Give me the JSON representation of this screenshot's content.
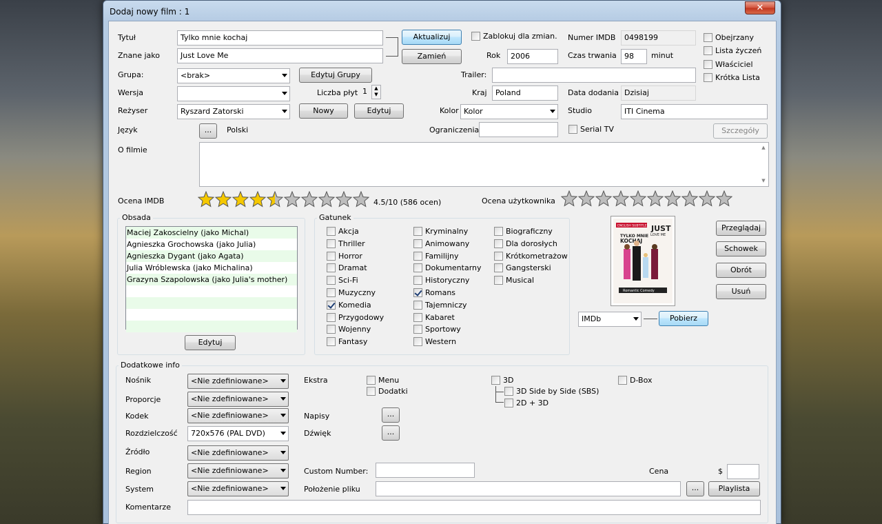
{
  "window": {
    "title": "Dodaj nowy film : 1",
    "close": "✕"
  },
  "main": {
    "title_label": "Tytuł",
    "title_value": "Tylko mnie kochaj",
    "alias_label": "Znane jako",
    "alias_value": "Just Love Me",
    "update_btn": "Aktualizuj",
    "swap_btn": "Zamień",
    "lock_label": "Zablokuj dla zmian.",
    "imdb_number_label": "Numer IMDB",
    "imdb_number_value": "0498199",
    "year_label": "Rok",
    "year_value": "2006",
    "runtime_label": "Czas trwania",
    "runtime_value": "98",
    "runtime_unit": "minut",
    "group_label": "Grupa:",
    "group_value": "<brak>",
    "edit_groups_btn": "Edytuj Grupy",
    "trailer_label": "Trailer:",
    "trailer_value": "",
    "version_label": "Wersja",
    "version_value": "",
    "discs_label": "Liczba płyt",
    "discs_value": "1",
    "country_label": "Kraj",
    "country_value": "Poland",
    "added_label": "Data dodania",
    "added_value": "Dzisiaj",
    "director_label": "Reżyser",
    "director_value": "Ryszard Zatorski",
    "new_btn": "Nowy",
    "edit_btn": "Edytuj",
    "color_label": "Kolor",
    "color_value": "Kolor",
    "studio_label": "Studio",
    "studio_value": "ITI Cinema",
    "language_label": "Język",
    "language_btn": "...",
    "language_value": "Polski",
    "restrictions_label": "Ograniczenia",
    "restrictions_value": "",
    "tv_series_label": "Serial TV",
    "details_btn": "Szczegóły",
    "about_label": "O filmie",
    "about_value": "",
    "imdb_rating_label": "Ocena IMDB",
    "imdb_rating_text": "4.5/10  (586 ocen)",
    "imdb_stars": 4.5,
    "user_rating_label": "Ocena użytkownika",
    "user_stars": 0
  },
  "flags": {
    "watched": "Obejrzany",
    "wishlist": "Lista życzeń",
    "owner": "Właściciel",
    "shortlist": "Krótka Lista"
  },
  "cast": {
    "title": "Obsada",
    "edit_btn": "Edytuj",
    "items": [
      "Maciej Zakoscielny  (jako Michal)",
      "Agnieszka Grochowska  (jako Julia)",
      "Agnieszka Dygant  (jako Agata)",
      "Julia Wróblewska  (jako Michalina)",
      "Grazyna Szapolowska  (jako Julia's mother)"
    ]
  },
  "genres": {
    "title": "Gatunek",
    "items": [
      {
        "label": "Akcja",
        "checked": false
      },
      {
        "label": "Thriller",
        "checked": false
      },
      {
        "label": "Horror",
        "checked": false
      },
      {
        "label": "Dramat",
        "checked": false
      },
      {
        "label": "Sci-Fi",
        "checked": false
      },
      {
        "label": "Muzyczny",
        "checked": false
      },
      {
        "label": "Komedia",
        "checked": true
      },
      {
        "label": "Przygodowy",
        "checked": false
      },
      {
        "label": "Wojenny",
        "checked": false
      },
      {
        "label": "Fantasy",
        "checked": false
      },
      {
        "label": "Kryminalny",
        "checked": false
      },
      {
        "label": "Animowany",
        "checked": false
      },
      {
        "label": "Familijny",
        "checked": false
      },
      {
        "label": "Dokumentarny",
        "checked": false
      },
      {
        "label": "Historyczny",
        "checked": false
      },
      {
        "label": "Romans",
        "checked": true
      },
      {
        "label": "Tajemniczy",
        "checked": false
      },
      {
        "label": "Kabaret",
        "checked": false
      },
      {
        "label": "Sportowy",
        "checked": false
      },
      {
        "label": "Western",
        "checked": false
      },
      {
        "label": "Biograficzny",
        "checked": false
      },
      {
        "label": "Dla dorosłych",
        "checked": false
      },
      {
        "label": "Krótkometrażow",
        "checked": false
      },
      {
        "label": "Gangsterski",
        "checked": false
      },
      {
        "label": "Musical",
        "checked": false
      }
    ]
  },
  "cover": {
    "browse_btn": "Przeglądaj",
    "clipboard_btn": "Schowek",
    "rotate_btn": "Obrót",
    "delete_btn": "Usuń",
    "source_value": "IMDb",
    "fetch_btn": "Pobierz",
    "banner": "ENGLISH SUBTITLES",
    "title1": "TYLKO MNIE",
    "title2": "KOCHAJ",
    "big1": "JUST",
    "big2": "LOVE ME",
    "genre": "Romantic Comedy"
  },
  "extra": {
    "title": "Dodatkowe info",
    "medium_label": "Nośnik",
    "medium_value": "<Nie zdefiniowane>",
    "aspect_label": "Proporcje",
    "aspect_value": "<Nie zdefiniowane>",
    "codec_label": "Kodek",
    "codec_value": "<Nie zdefiniowane>",
    "resolution_label": "Rozdzielczość",
    "resolution_value": "720x576 (PAL DVD)",
    "source_label": "Źródło",
    "source_value": "<Nie zdefiniowane>",
    "region_label": "Region",
    "region_value": "<Nie zdefiniowane>",
    "system_label": "System",
    "system_value": "<Nie zdefiniowane>",
    "comments_label": "Komentarze",
    "comments_value": "",
    "extras_label": "Ekstra",
    "menu_label": "Menu",
    "addons_label": "Dodatki",
    "subtitles_label": "Napisy",
    "sound_label": "Dźwięk",
    "dots": "...",
    "d3_label": "3D",
    "sbs_label": "3D Side by Side (SBS)",
    "twod_label": "2D + 3D",
    "dbox_label": "D-Box",
    "custom_label": "Custom Number:",
    "custom_value": "",
    "price_label": "Cena",
    "currency": "$",
    "price_value": "",
    "filepath_label": "Położenie pliku",
    "filepath_value": "",
    "playlist_btn": "Playlista"
  }
}
